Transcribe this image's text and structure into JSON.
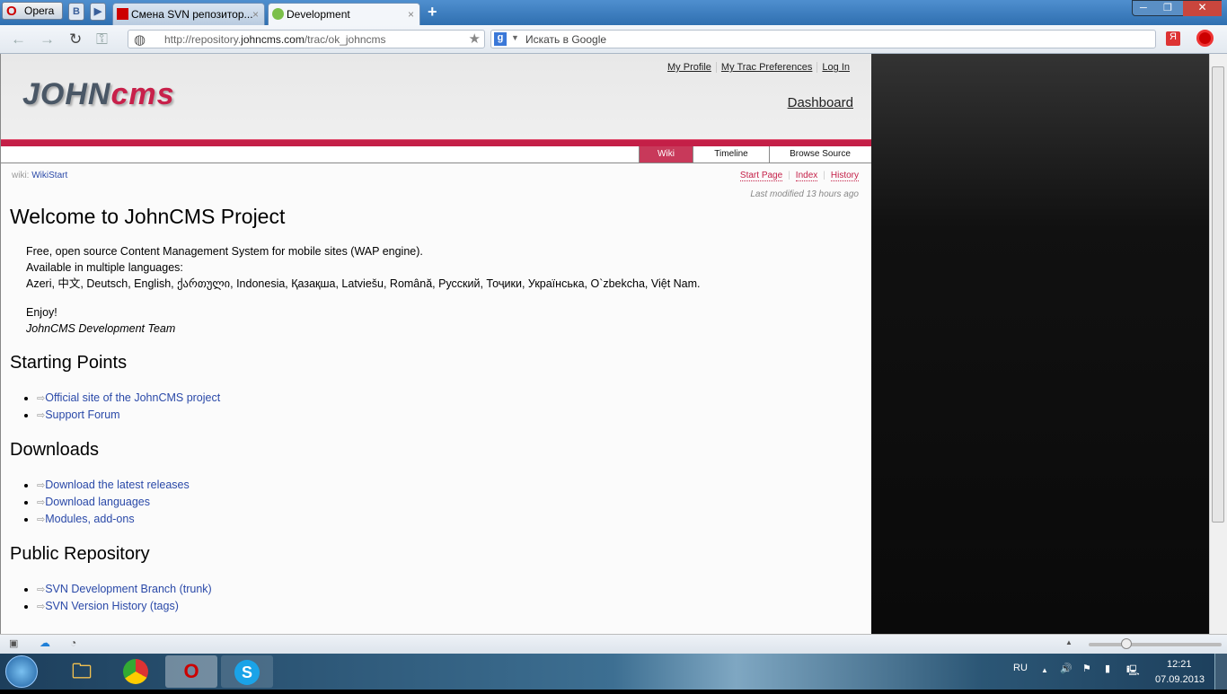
{
  "browser": {
    "menu_label": "Opera",
    "speed_dial_1": "B",
    "speed_dial_2": "▶",
    "tabs": [
      {
        "label": "Смена SVN репозитор...",
        "active": false
      },
      {
        "label": "Development",
        "active": true
      }
    ],
    "new_tab": "+",
    "url_prefix": "http://repository.",
    "url_domain": "johncms.com",
    "url_path": "/trac/ok_johncms",
    "search_placeholder": "Искать в Google",
    "search_engine": "g"
  },
  "page": {
    "logo": {
      "part1": "JOHN",
      "part2": "cms"
    },
    "meta_nav": [
      "My Profile",
      "My Trac Preferences",
      "Log In"
    ],
    "dashboard": "Dashboard",
    "main_nav": [
      {
        "label": "Wiki",
        "active": true
      },
      {
        "label": "Timeline"
      },
      {
        "label": "Browse Source"
      }
    ],
    "breadcrumb_prefix": "wiki:",
    "breadcrumb_page": "WikiStart",
    "ctx_nav": [
      "Start Page",
      "Index",
      "History"
    ],
    "last_modified": "Last modified 13 hours ago",
    "title": "Welcome to JohnCMS Project",
    "intro": [
      "Free, open source Content Management System for mobile sites (WAP engine).",
      "Available in multiple languages:",
      "Azeri, 中文, Deutsch, English, ქართული, Indonesia, Қазақша, Latviešu, Română, Русский, Тоҷики, Українська, O`zbekcha, Việt Nam."
    ],
    "enjoy": "Enjoy!",
    "team": "JohnCMS Development Team",
    "sections": [
      {
        "heading": "Starting Points",
        "links": [
          "Official site of the JohnCMS project",
          "Support Forum"
        ]
      },
      {
        "heading": "Downloads",
        "links": [
          "Download the latest releases",
          "Download languages",
          "Modules, add-ons"
        ]
      },
      {
        "heading": "Public Repository",
        "links": [
          "SVN Development Branch (trunk)",
          "SVN Version History (tags)"
        ]
      }
    ],
    "ext_icon": "⇨"
  },
  "taskbar": {
    "lang": "RU",
    "time": "12:21",
    "date": "07.09.2013"
  },
  "colors": {
    "accent": "#c41f47",
    "link": "#2a49a8"
  }
}
